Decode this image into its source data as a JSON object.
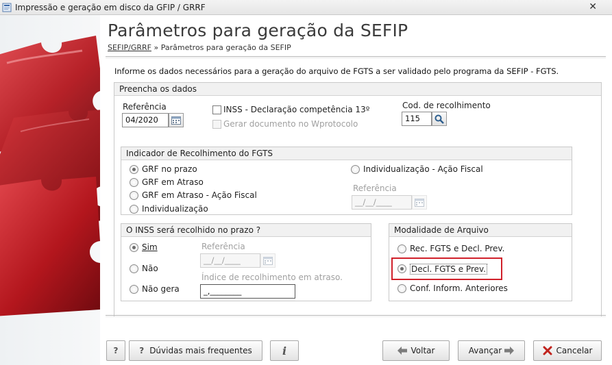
{
  "window": {
    "title": "Impressão e geração em disco da GFIP / GRRF"
  },
  "header": {
    "title": "Parâmetros para geração da SEFIP",
    "breadcrumb_link": "SEFIP/GRRF",
    "breadcrumb_sep": "»",
    "breadcrumb_current": "Parâmetros para geração da SEFIP"
  },
  "intro": "Informe os dados necessários para a geração do arquivo de FGTS a ser validado pelo programa da SEFIP - FGTS.",
  "dados": {
    "legend": "Preencha os dados",
    "referencia_label": "Referência",
    "referencia_value": "04/2020",
    "inss13_label": "INSS - Declaração competência 13º",
    "wprotocolo_label": "Gerar documento no Wprotocolo",
    "cod_label": "Cod. de recolhimento",
    "cod_value": "115"
  },
  "indicador": {
    "legend": "Indicador de Recolhimento do FGTS",
    "opt_prazo": "GRF no prazo",
    "opt_atraso": "GRF em Atraso",
    "opt_atraso_fiscal": "GRF em Atraso - Ação Fiscal",
    "opt_indiv": "Individualização",
    "opt_indiv_fiscal": "Individualização - Ação Fiscal",
    "ref_label": "Referência",
    "ref_value": "__/__/____"
  },
  "inss": {
    "legend": "O INSS será recolhido no prazo ?",
    "opt_sim": "Sim",
    "opt_nao": "Não",
    "opt_naogera": "Não gera",
    "ref_label": "Referência",
    "ref_value": "__/__/____",
    "indice_label": "Índice de recolhimento em atraso.",
    "indice_value": "_,________"
  },
  "modalidade": {
    "legend": "Modalidade de Arquivo",
    "opt_rec": "Rec. FGTS e Decl. Prev.",
    "opt_decl": "Decl. FGTS e Prev.",
    "opt_conf": "Conf. Inform. Anteriores"
  },
  "buttons": {
    "help": "?",
    "faq_icon": "?",
    "faq": "Dúvidas mais frequentes",
    "info": "i",
    "voltar": "Voltar",
    "avancar": "Avançar",
    "cancelar": "Cancelar"
  },
  "colors": {
    "accent_red": "#d0202a",
    "puzzle_red": "#b8181f"
  }
}
